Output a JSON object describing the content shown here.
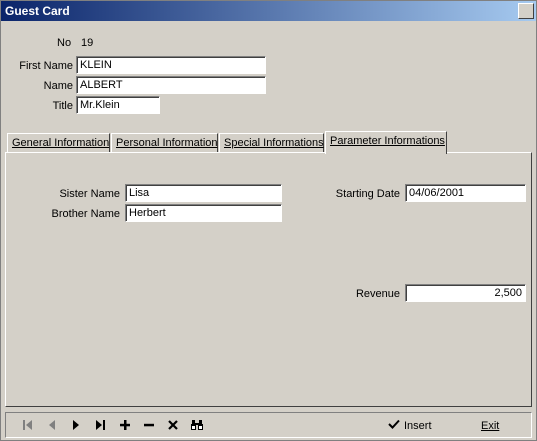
{
  "window": {
    "title": "Guest Card"
  },
  "header": {
    "no_label": "No",
    "no_value": "19",
    "first_name_label": "First Name",
    "first_name_value": "KLEIN",
    "name_label": "Name",
    "name_value": "ALBERT",
    "title_label": "Title",
    "title_value": "Mr.Klein"
  },
  "tabs": [
    {
      "label": "General Information"
    },
    {
      "label": "Personal Information"
    },
    {
      "label": "Special Informations"
    },
    {
      "label": "Parameter Informations"
    }
  ],
  "panel": {
    "sister_name_label": "Sister Name",
    "sister_name_value": "Lisa",
    "brother_name_label": "Brother Name",
    "brother_name_value": "Herbert",
    "starting_date_label": "Starting Date",
    "starting_date_value": "04/06/2001",
    "revenue_label": "Revenue",
    "revenue_value": "2,500"
  },
  "toolbar": {
    "first_icon": "first-record-icon",
    "prev_icon": "prev-record-icon",
    "next_icon": "next-record-icon",
    "last_icon": "last-record-icon",
    "add_icon": "plus-icon",
    "delete_icon": "minus-icon",
    "cancel_icon": "x-icon",
    "find_icon": "binoculars-icon",
    "insert_label": "Insert",
    "exit_label": "Exit"
  }
}
